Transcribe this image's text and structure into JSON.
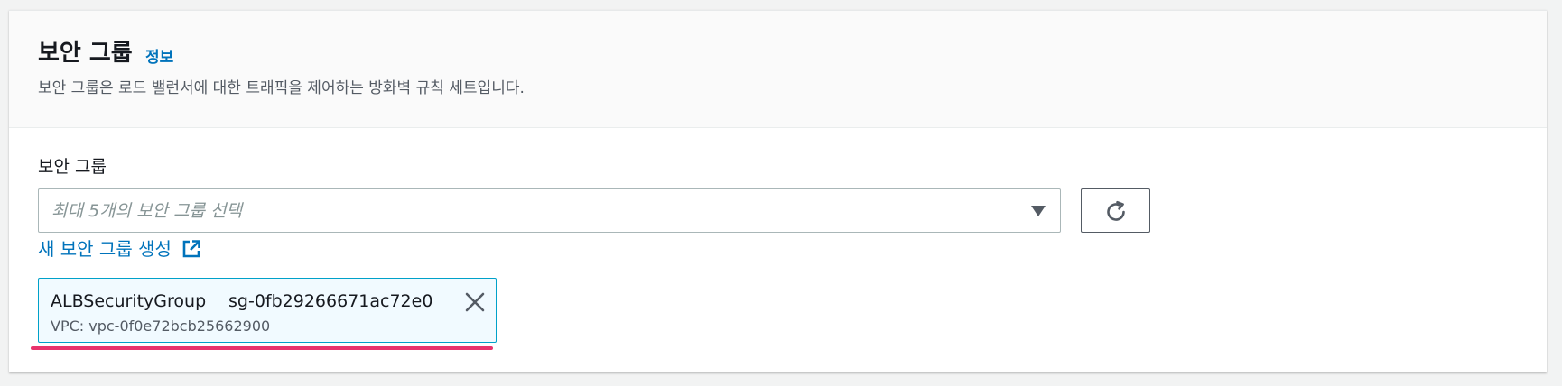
{
  "section": {
    "title": "보안 그룹",
    "info_link": "정보",
    "description": "보안 그룹은 로드 밸런서에 대한 트래픽을 제어하는 방화벽 규칙 세트입니다."
  },
  "field": {
    "label": "보안 그룹",
    "placeholder": "최대 5개의 보안 그룹 선택",
    "create_link": "새 보안 그룹 생성"
  },
  "selected_groups": [
    {
      "name": "ALBSecurityGroup",
      "id": "sg-0fb29266671ac72e0",
      "vpc": "VPC: vpc-0f0e72bcb25662900"
    }
  ],
  "icons": {
    "dropdown": "caret-down-icon",
    "refresh": "refresh-icon",
    "external": "external-link-icon",
    "remove": "close-icon"
  },
  "colors": {
    "link": "#0073bb",
    "token_border": "#00a1c9",
    "token_background": "#f1faff",
    "annotation": "#e8336c"
  }
}
